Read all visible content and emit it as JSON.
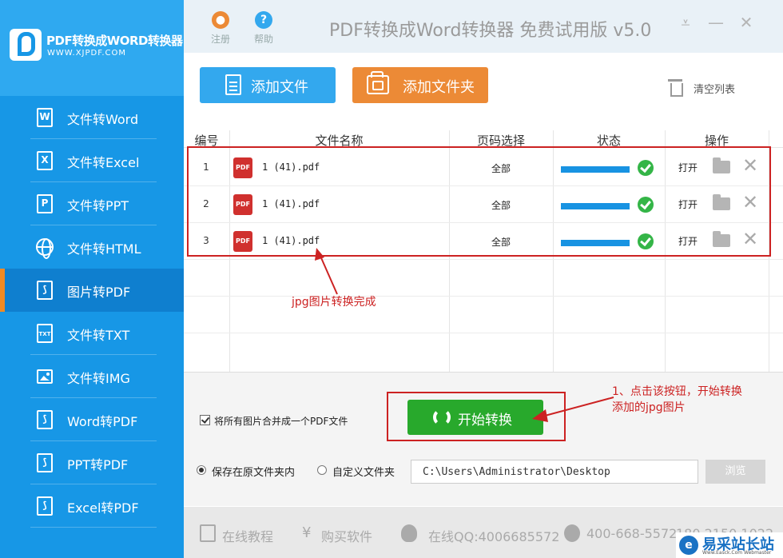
{
  "brand": {
    "name": "PDF转换成WORD转换器",
    "url": "WWW.XJPDF.COM"
  },
  "sidebar": {
    "items": [
      {
        "label": "文件转Word",
        "icon": "word-icon",
        "glyph": "W"
      },
      {
        "label": "文件转Excel",
        "icon": "excel-icon",
        "glyph": "X"
      },
      {
        "label": "文件转PPT",
        "icon": "ppt-icon",
        "glyph": "P"
      },
      {
        "label": "文件转HTML",
        "icon": "globe-icon",
        "glyph": ""
      },
      {
        "label": "图片转PDF",
        "icon": "pdf-icon",
        "glyph": "⟆",
        "active": true
      },
      {
        "label": "文件转TXT",
        "icon": "txt-icon",
        "glyph": "TXT"
      },
      {
        "label": "文件转IMG",
        "icon": "image-icon",
        "glyph": ""
      },
      {
        "label": "Word转PDF",
        "icon": "word-pdf-icon",
        "glyph": "⟆"
      },
      {
        "label": "PPT转PDF",
        "icon": "ppt-pdf-icon",
        "glyph": "⟆"
      },
      {
        "label": "Excel转PDF",
        "icon": "excel-pdf-icon",
        "glyph": "⟆"
      }
    ]
  },
  "header": {
    "register_label": "注册",
    "help_label": "帮助",
    "help_glyph": "?",
    "title": "PDF转换成Word转换器 免费试用版 v5.0",
    "min_tray_glyph": "⩡",
    "minimize_glyph": "—",
    "close_glyph": "✕"
  },
  "toolbar": {
    "add_file": "添加文件",
    "add_folder": "添加文件夹",
    "clear_list": "清空列表"
  },
  "table": {
    "columns": [
      "编号",
      "文件名称",
      "页码选择",
      "状态",
      "操作"
    ],
    "rows": [
      {
        "num": "1",
        "file": "1 (41).pdf",
        "pages": "全部",
        "progress": 1.0,
        "action": "打开"
      },
      {
        "num": "2",
        "file": "1 (41).pdf",
        "pages": "全部",
        "progress": 1.0,
        "action": "打开"
      },
      {
        "num": "3",
        "file": "1 (41).pdf",
        "pages": "全部",
        "progress": 1.0,
        "action": "打开"
      }
    ],
    "pdf_badge": "PDF",
    "delete_glyph": "✕"
  },
  "annotations": {
    "done": "jpg图片转换完成",
    "step1_line1": "1、点击该按钮，开始转换",
    "step1_line2": "添加的jpg图片"
  },
  "options": {
    "merge_label": "将所有图片合并成一个PDF文件",
    "merge_checked": true,
    "start_label": "开始转换",
    "save_original": "保存在原文件夹内",
    "save_custom": "自定义文件夹",
    "path_value": "C:\\Users\\Administrator\\Desktop",
    "browse_label": "浏览"
  },
  "footer": {
    "tutorial": "在线教程",
    "buy": "购买软件",
    "buy_glyph": "¥",
    "qq": "在线QQ:4006685572",
    "phone": "400-668-5572",
    "phone_extra": "180 2150 1022"
  },
  "watermark": {
    "logo_glyph": "e",
    "text": "易采站长站",
    "sub": "Www.Easck.Com Webmaster"
  },
  "colors": {
    "sidebar": "#1797e6",
    "accent_orange": "#ec8a36",
    "accent_blue": "#33a8ee",
    "start_green": "#28a92c",
    "annotation_red": "#cc2222"
  }
}
